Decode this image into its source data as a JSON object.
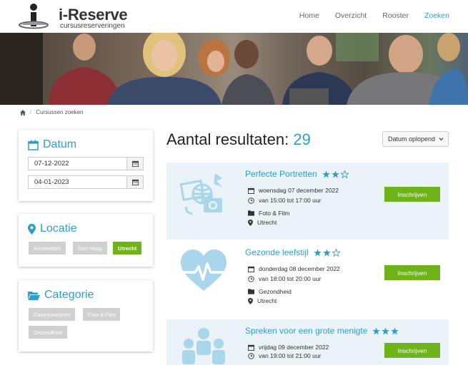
{
  "brand": {
    "title": "i-Reserve",
    "subtitle": "cursusreserveringen"
  },
  "nav": {
    "items": [
      "Home",
      "Overzicht",
      "Rooster",
      "Zoeken"
    ],
    "active": "Zoeken"
  },
  "breadcrumb": {
    "current": "Cursussen zoeken"
  },
  "filters": {
    "datum": {
      "title": "Datum",
      "from": "07-12-2022",
      "to": "04-01-2023"
    },
    "locatie": {
      "title": "Locatie",
      "options": [
        "Amsterdam",
        "Den Haag",
        "Utrecht"
      ],
      "selected": "Utrecht"
    },
    "categorie": {
      "title": "Categorie",
      "options": [
        "Communiceren",
        "Foto & Film",
        "Gezondheid"
      ]
    }
  },
  "results": {
    "label": "Aantal resultaten:",
    "count": "29",
    "sort": "Datum oplopend",
    "enroll_label": "Inschrijven",
    "items": [
      {
        "title": "Perfecte Portretten",
        "stars": 2,
        "max_stars": 3,
        "date": "woensdag 07 december 2022",
        "time": "van 15:00 tot 17:00 uur",
        "category": "Foto & Film",
        "location": "Utrecht",
        "icon": "photo-camera-icon"
      },
      {
        "title": "Gezonde leefstijl",
        "stars": 2,
        "max_stars": 3,
        "date": "donderdag 08 december 2022",
        "time": "van 18:00 tot 20:00 uur",
        "category": "Gezondheid",
        "location": "Utrecht",
        "icon": "heartbeat-icon"
      },
      {
        "title": "Spreken voor een grote menigte",
        "stars": 3,
        "max_stars": 3,
        "date": "vrijdag 09 december 2022",
        "time": "van 19:00 tot 21:00 uur",
        "category": "",
        "location": "",
        "icon": "audience-icon"
      }
    ]
  },
  "colors": {
    "accent": "#2f9ec9",
    "green": "#6fb31a",
    "tag_inactive": "#d0d0d0",
    "card_bg": "#e9f3f8"
  }
}
